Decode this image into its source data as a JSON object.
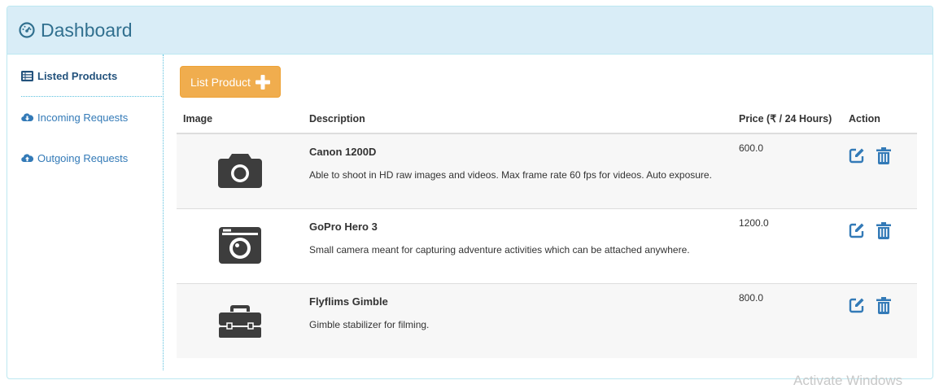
{
  "header": {
    "title": "Dashboard",
    "icon": "dashboard-icon"
  },
  "sidebar": {
    "items": [
      {
        "label": "Listed Products",
        "icon": "list-icon",
        "active": true
      },
      {
        "label": "Incoming Requests",
        "icon": "cloud-download-icon",
        "active": false
      },
      {
        "label": "Outgoing Requests",
        "icon": "cloud-upload-icon",
        "active": false
      }
    ]
  },
  "toolbar": {
    "list_product_label": "List Product",
    "icon": "plus-icon"
  },
  "table": {
    "columns": [
      "Image",
      "Description",
      "Price (₹ / 24 Hours)",
      "Action"
    ],
    "rows": [
      {
        "name": "Canon 1200D",
        "description": "Able to shoot in HD raw images and videos. Max frame rate 60 fps for videos. Auto exposure.",
        "price": "600.0",
        "icon": "camera-icon"
      },
      {
        "name": "GoPro Hero 3",
        "description": "Small camera meant for capturing adventure activities which can be attached anywhere.",
        "price": "1200.0",
        "icon": "camera-retro-icon"
      },
      {
        "name": "Flyflims Gimble",
        "description": "Gimble stabilizer for filming.",
        "price": "800.0",
        "icon": "toolbox-icon"
      }
    ]
  },
  "watermark": "Activate Windows",
  "colors": {
    "accent": "#337ab7",
    "heading_bg": "#d9edf7",
    "button": "#f0ad4e"
  }
}
